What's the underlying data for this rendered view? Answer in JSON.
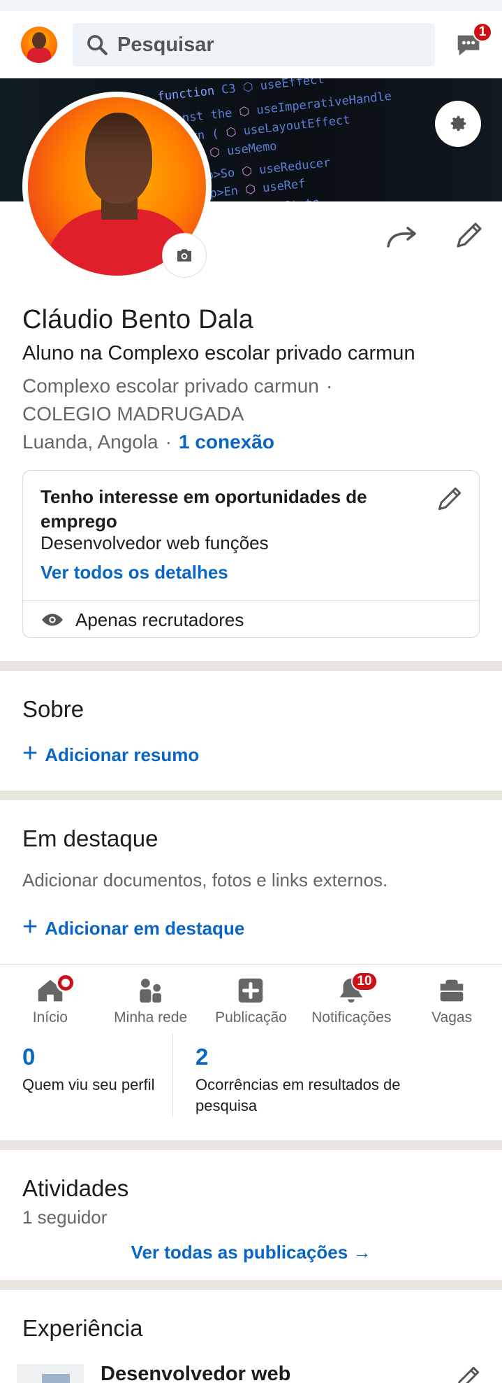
{
  "topbar": {
    "search_placeholder": "Pesquisar",
    "messages_badge": "1"
  },
  "profile": {
    "name": "Cláudio Bento Dala",
    "headline": "Aluno na Complexo escolar privado carmun",
    "school": "Complexo escolar privado carmun",
    "school2": "COLEGIO MADRUGADA",
    "location": "Luanda, Angola",
    "connections": "1 conexão"
  },
  "open_to_work": {
    "title": "Tenho interesse em oportunidades de emprego",
    "role": "Desenvolvedor web funções",
    "details_link": "Ver todos os detalhes",
    "visibility": "Apenas recrutadores"
  },
  "about": {
    "title": "Sobre",
    "add_label": "Adicionar resumo"
  },
  "featured": {
    "title": "Em destaque",
    "description": "Adicionar documentos, fotos e links externos.",
    "add_label": "Adicionar em destaque"
  },
  "bottom_nav": {
    "items": [
      {
        "label": "Início"
      },
      {
        "label": "Minha rede"
      },
      {
        "label": "Publicação"
      },
      {
        "label": "Notificações",
        "badge": "10"
      },
      {
        "label": "Vagas"
      }
    ]
  },
  "stats": {
    "views_count": "0",
    "views_label": "Quem viu seu perfil",
    "search_count": "2",
    "search_label": "Ocorrências em resultados de pesquisa"
  },
  "activity": {
    "title": "Atividades",
    "followers": "1 seguidor",
    "see_all": "Ver todas as publicações →"
  },
  "experience": {
    "title": "Experiência",
    "first_role": "Desenvolvedor web"
  },
  "colors": {
    "accent": "#0a66c2",
    "badge": "#cc1016",
    "section_separator": "#e9e5df"
  }
}
